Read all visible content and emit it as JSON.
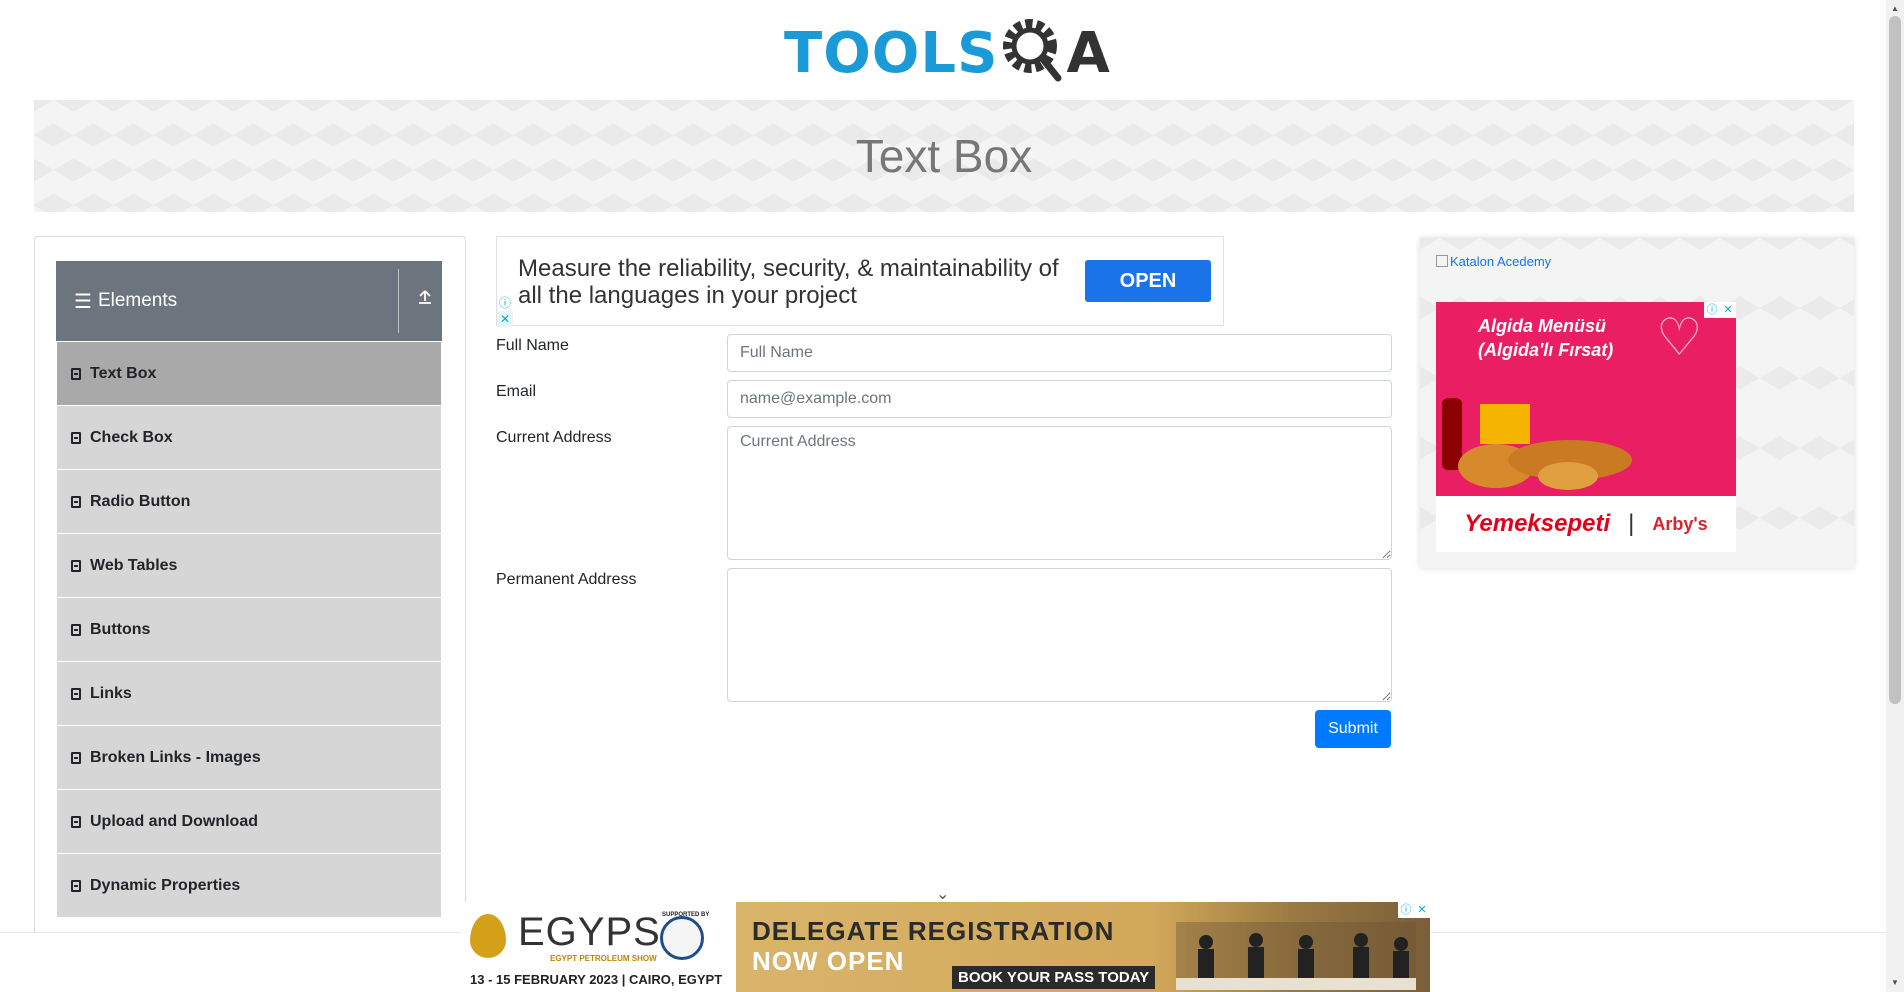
{
  "logo": {
    "text_tools": "TOOLS",
    "text_a": "A"
  },
  "banner": {
    "title": "Text Box"
  },
  "sidebar": {
    "group_title": "Elements",
    "items": [
      {
        "label": "Text Box",
        "active": true
      },
      {
        "label": "Check Box"
      },
      {
        "label": "Radio Button"
      },
      {
        "label": "Web Tables"
      },
      {
        "label": "Buttons"
      },
      {
        "label": "Links"
      },
      {
        "label": "Broken Links - Images"
      },
      {
        "label": "Upload and Download"
      },
      {
        "label": "Dynamic Properties"
      }
    ]
  },
  "ad_top": {
    "message": "Measure the reliability, security, & maintainability of all the languages in your project",
    "button": "OPEN"
  },
  "form": {
    "full_name": {
      "label": "Full Name",
      "placeholder": "Full Name",
      "value": ""
    },
    "email": {
      "label": "Email",
      "placeholder": "name@example.com",
      "value": ""
    },
    "current_address": {
      "label": "Current Address",
      "placeholder": "Current Address",
      "value": ""
    },
    "permanent_address": {
      "label": "Permanent Address",
      "placeholder": "",
      "value": ""
    },
    "submit": "Submit"
  },
  "right_ad": {
    "katalon_alt": "Katalon Acedemy",
    "food_title_line1": "Algida Menüsü",
    "food_title_line2": "(Algida'lı Fırsat)",
    "brand1": "Yemeksepeti",
    "brand2": "Arby's"
  },
  "bottom_ad": {
    "egyps_logo": "EGYPS",
    "egyps_sub": "EGYPT PETROLEUM SHOW",
    "supported_by": "SUPPORTED BY",
    "date": "13 - 15 FEBRUARY 2023 | CAIRO, EGYPT",
    "headline1": "DELEGATE REGISTRATION",
    "headline2": "NOW OPEN",
    "cta": "BOOK YOUR PASS TODAY"
  },
  "colors": {
    "accent": "#1a9ad6",
    "sidebar_header": "#6c757d",
    "menu_item": "#d6d6d6",
    "menu_item_active": "#a9a9a9",
    "submit": "#007bff"
  }
}
